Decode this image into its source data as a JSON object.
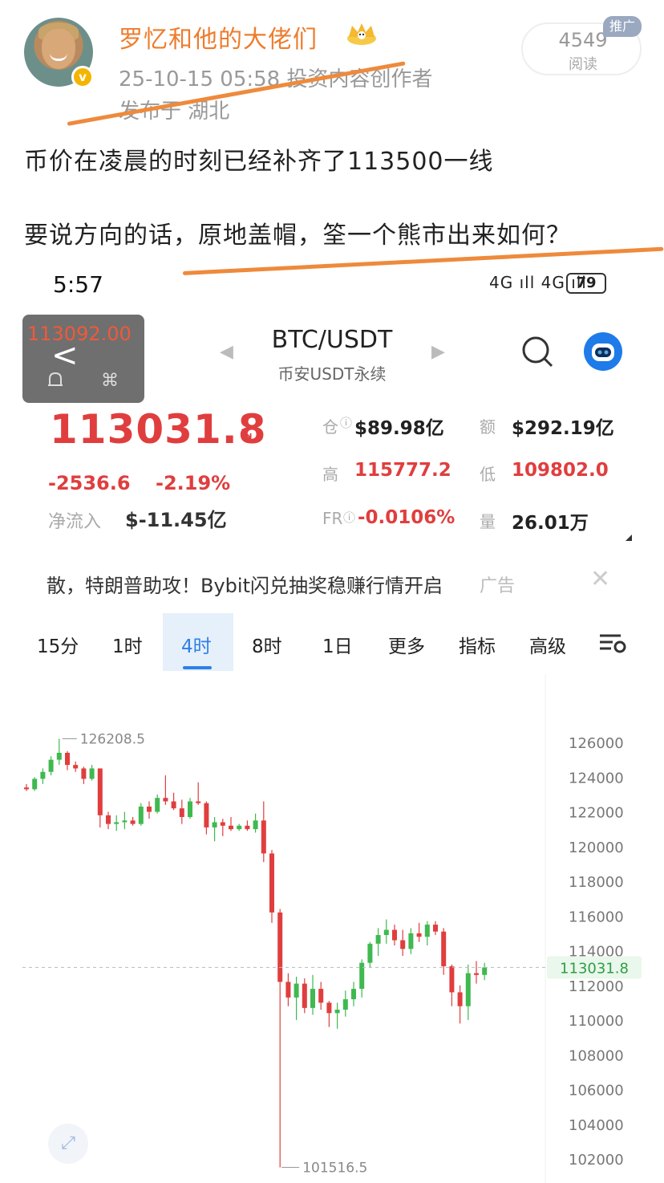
{
  "post": {
    "username": "罗忆和他的大佬们",
    "meta": "25-10-15 05:58 投资内容创作者",
    "location": "发布于 湖北",
    "read_count": "4549",
    "read_label": "阅读",
    "promo_badge": "推广",
    "line1": "币价在凌晨的时刻已经补齐了113500一线",
    "line2": "要说方向的话，原地盖帽，筌一个熊市出来如何？",
    "accent_color": "#ee7c2d"
  },
  "status_bar": {
    "time": "5:57",
    "signals": "4G ıll 4G ıll",
    "battery": "79"
  },
  "float_widget": {
    "price": "113092.00"
  },
  "header": {
    "pair": "BTC/USDT",
    "subtitle": "币安USDT永续"
  },
  "ticker": {
    "price": "113031.8",
    "change_abs": "-2536.6",
    "change_pct": "-2.19%",
    "net_inflow_label": "净流入",
    "net_inflow_value": "$-11.45亿",
    "oi_label": "仓",
    "oi_value": "$89.98亿",
    "vol_amt_label": "额",
    "vol_amt_value": "$292.19亿",
    "high_label": "高",
    "high_value": "115777.2",
    "low_label": "低",
    "low_value": "109802.0",
    "fr_label": "FR",
    "fr_value": "-0.0106%",
    "qty_label": "量",
    "qty_value": "26.01万",
    "up_color": "#3fb950",
    "down_color": "#e03e3e"
  },
  "ad": {
    "text": "散，特朗普助攻！Bybit闪兑抽奖稳赚行情开启",
    "tag": "广告"
  },
  "timeframes": [
    "15分",
    "1时",
    "4时",
    "8时",
    "1日",
    "更多",
    "指标",
    "高级"
  ],
  "active_timeframe": "4时",
  "chart_data": {
    "type": "candlestick",
    "y_ticks": [
      126000,
      124000,
      122000,
      120000,
      118000,
      116000,
      114000,
      112000,
      110000,
      108000,
      106000,
      104000,
      102000
    ],
    "ylim": [
      101200,
      127400
    ],
    "current_price_label": "113031.8",
    "current_price": 113031.8,
    "max_label": "126208.5",
    "max_value": 126208.5,
    "min_label": "101516.5",
    "min_value": 101516.5,
    "candles": [
      [
        123400,
        123600,
        123200,
        123300
      ],
      [
        123300,
        124000,
        123200,
        123900
      ],
      [
        123900,
        124500,
        123600,
        124300
      ],
      [
        124300,
        125200,
        124100,
        125000
      ],
      [
        125000,
        126208,
        124700,
        125400
      ],
      [
        125400,
        125500,
        124400,
        124700
      ],
      [
        124700,
        124900,
        124300,
        124500
      ],
      [
        124500,
        124600,
        123600,
        123900
      ],
      [
        123900,
        124700,
        123800,
        124500
      ],
      [
        124500,
        124500,
        121100,
        121800
      ],
      [
        121800,
        122000,
        121000,
        121300
      ],
      [
        121300,
        121800,
        120900,
        121400
      ],
      [
        121400,
        122000,
        121000,
        121500
      ],
      [
        121500,
        121700,
        121200,
        121300
      ],
      [
        121300,
        122500,
        121200,
        122300
      ],
      [
        122300,
        122600,
        121600,
        122000
      ],
      [
        122000,
        123000,
        121900,
        122800
      ],
      [
        122800,
        124100,
        122400,
        122600
      ],
      [
        122600,
        123100,
        122100,
        122200
      ],
      [
        122200,
        122700,
        121300,
        121700
      ],
      [
        121700,
        122800,
        121600,
        122600
      ],
      [
        122600,
        123700,
        122400,
        122500
      ],
      [
        122500,
        122600,
        120700,
        121100
      ],
      [
        121100,
        121700,
        120300,
        121400
      ],
      [
        121400,
        121600,
        120600,
        121200
      ],
      [
        121200,
        121700,
        120900,
        121000
      ],
      [
        121000,
        121300,
        120900,
        121200
      ],
      [
        121200,
        121500,
        120900,
        121000
      ],
      [
        121000,
        121900,
        120800,
        121500
      ],
      [
        121500,
        122600,
        119100,
        119600
      ],
      [
        119600,
        119800,
        115600,
        116200
      ],
      [
        116200,
        116400,
        101516,
        112200
      ],
      [
        112200,
        112700,
        110800,
        111300
      ],
      [
        111300,
        112500,
        110000,
        112100
      ],
      [
        112100,
        112400,
        110400,
        110700
      ],
      [
        110700,
        112600,
        110300,
        111800
      ],
      [
        111800,
        112200,
        110600,
        111000
      ],
      [
        111000,
        111100,
        109600,
        110400
      ],
      [
        110400,
        111000,
        109500,
        110600
      ],
      [
        110600,
        111700,
        110200,
        111200
      ],
      [
        111200,
        112200,
        110800,
        111800
      ],
      [
        111800,
        113500,
        111300,
        113300
      ],
      [
        113300,
        114500,
        113000,
        114400
      ],
      [
        114400,
        115300,
        113700,
        114900
      ],
      [
        114900,
        115800,
        114400,
        115200
      ],
      [
        115200,
        115500,
        114300,
        114600
      ],
      [
        114600,
        115200,
        113700,
        114100
      ],
      [
        114100,
        115300,
        113800,
        115000
      ],
      [
        115000,
        115600,
        114500,
        114800
      ],
      [
        114800,
        115700,
        114300,
        115500
      ],
      [
        115500,
        115700,
        114900,
        115100
      ],
      [
        115100,
        115300,
        112600,
        113100
      ],
      [
        113100,
        113200,
        110800,
        111600
      ],
      [
        111600,
        112000,
        109800,
        110800
      ],
      [
        110800,
        113200,
        110000,
        112700
      ],
      [
        112700,
        113400,
        112100,
        112600
      ],
      [
        112600,
        113300,
        112300,
        113031.8
      ]
    ]
  }
}
